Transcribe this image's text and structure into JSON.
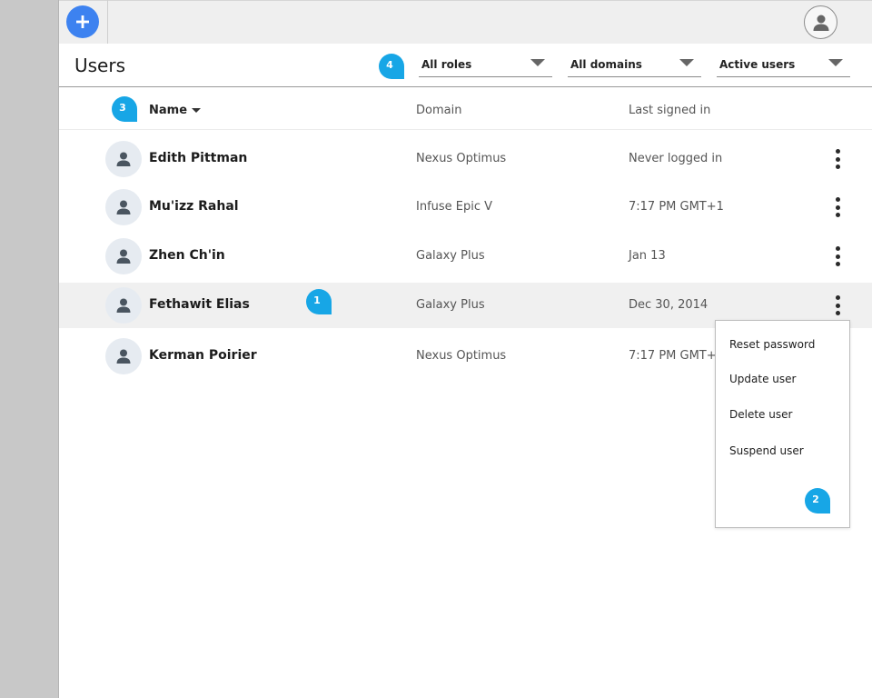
{
  "app": {
    "page_title": "Users",
    "add_button_icon": "plus-icon",
    "account_icon": "account-avatar-icon",
    "accent_color": "#3d82f0",
    "callout_color": "#17a6e6"
  },
  "filters": [
    {
      "label": "All roles",
      "icon": "dropdown-caret-icon"
    },
    {
      "label": "All domains",
      "icon": "dropdown-caret-icon"
    },
    {
      "label": "Active users",
      "icon": "dropdown-caret-icon"
    }
  ],
  "table": {
    "columns": {
      "name": "Name",
      "domain": "Domain",
      "last_signed_in": "Last signed in"
    },
    "sort": {
      "column": "Name",
      "direction": "descending"
    },
    "rows": [
      {
        "name": "Edith Pittman",
        "domain": "Nexus Optimus",
        "last_signed_in": "Never logged in",
        "selected": false
      },
      {
        "name": "Mu'izz Rahal",
        "domain": "Infuse Epic V",
        "last_signed_in": "7:17 PM GMT+1",
        "selected": false
      },
      {
        "name": "Zhen Ch'in",
        "domain": "Galaxy Plus",
        "last_signed_in": "Jan 13",
        "selected": false
      },
      {
        "name": "Fethawit Elias",
        "domain": "Galaxy Plus",
        "last_signed_in": "Dec 30, 2014",
        "selected": true
      },
      {
        "name": "Kerman Poirier",
        "domain": "Nexus Optimus",
        "last_signed_in": "7:17 PM GMT+1",
        "selected": false
      }
    ]
  },
  "context_menu": {
    "items": [
      "Reset password",
      "Update user",
      "Delete user",
      "Suspend user"
    ]
  },
  "callouts": [
    "1",
    "2",
    "3",
    "4"
  ]
}
